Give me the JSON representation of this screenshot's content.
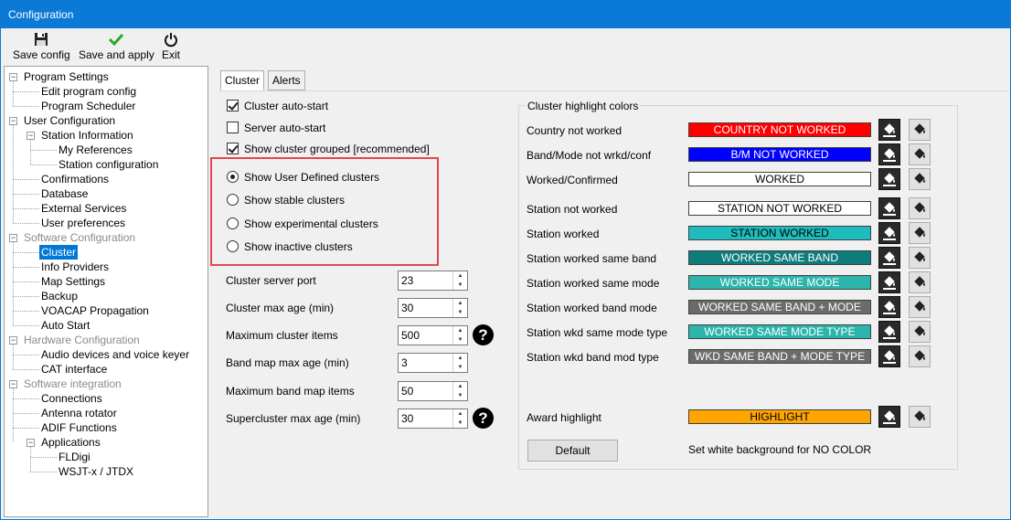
{
  "window": {
    "title": "Configuration"
  },
  "toolbar": {
    "save_config": "Save config",
    "save_and_apply": "Save and apply",
    "exit": "Exit"
  },
  "tree": [
    {
      "label": "Program Settings",
      "level": 0,
      "expander": "minus"
    },
    {
      "label": "Edit program config",
      "level": 1
    },
    {
      "label": "Program Scheduler",
      "level": 1
    },
    {
      "label": "User Configuration",
      "level": 0,
      "expander": "minus"
    },
    {
      "label": "Station Information",
      "level": 1,
      "expander": "minus"
    },
    {
      "label": "My References",
      "level": 2
    },
    {
      "label": "Station configuration",
      "level": 2
    },
    {
      "label": "Confirmations",
      "level": 1
    },
    {
      "label": "Database",
      "level": 1
    },
    {
      "label": "External Services",
      "level": 1
    },
    {
      "label": "User preferences",
      "level": 1
    },
    {
      "label": "Software Configuration",
      "level": 0,
      "expander": "minus",
      "grey": true
    },
    {
      "label": "Cluster",
      "level": 1,
      "selected": true
    },
    {
      "label": "Info Providers",
      "level": 1
    },
    {
      "label": "Map Settings",
      "level": 1
    },
    {
      "label": "Backup",
      "level": 1
    },
    {
      "label": "VOACAP Propagation",
      "level": 1
    },
    {
      "label": "Auto Start",
      "level": 1
    },
    {
      "label": "Hardware Configuration",
      "level": 0,
      "expander": "minus",
      "grey": true
    },
    {
      "label": "Audio devices and voice keyer",
      "level": 1
    },
    {
      "label": "CAT interface",
      "level": 1
    },
    {
      "label": "Software integration",
      "level": 0,
      "expander": "minus",
      "grey": true
    },
    {
      "label": "Connections",
      "level": 1
    },
    {
      "label": "Antenna rotator",
      "level": 1
    },
    {
      "label": "ADIF Functions",
      "level": 1
    },
    {
      "label": "Applications",
      "level": 1,
      "expander": "minus"
    },
    {
      "label": "FLDigi",
      "level": 2
    },
    {
      "label": "WSJT-x / JTDX",
      "level": 2
    }
  ],
  "tabs": [
    {
      "label": "Cluster",
      "active": true
    },
    {
      "label": "Alerts",
      "active": false
    }
  ],
  "cluster": {
    "checkboxes": [
      {
        "label": "Cluster auto-start",
        "checked": true
      },
      {
        "label": "Server auto-start",
        "checked": false
      },
      {
        "label": "Show cluster grouped [recommended]",
        "checked": true
      }
    ],
    "radios": [
      {
        "label": "Show User Defined clusters",
        "selected": true
      },
      {
        "label": "Show stable clusters",
        "selected": false
      },
      {
        "label": "Show experimental clusters",
        "selected": false
      },
      {
        "label": "Show inactive clusters",
        "selected": false
      }
    ],
    "fields": [
      {
        "label": "Cluster server port",
        "value": "23",
        "help": false
      },
      {
        "label": "Cluster max age (min)",
        "value": "30",
        "help": false
      },
      {
        "label": "Maximum cluster items",
        "value": "500",
        "help": true
      },
      {
        "label": "Band map max age (min)",
        "value": "3",
        "help": false
      },
      {
        "label": "Maximum band map items",
        "value": "50",
        "help": false
      },
      {
        "label": "Supercluster max age (min)",
        "value": "30",
        "help": true
      }
    ],
    "help_glyph": "?"
  },
  "highlight": {
    "title": "Cluster highlight colors",
    "rows": [
      {
        "label": "Country not worked",
        "text": "COUNTRY NOT WORKED",
        "bg": "#ff0000",
        "fg": "#ffffff"
      },
      {
        "label": "Band/Mode not wrkd/conf",
        "text": "B/M NOT WORKED",
        "bg": "#0000ff",
        "fg": "#ffffff"
      },
      {
        "label": "Worked/Confirmed",
        "text": "WORKED",
        "bg": "#ffffff",
        "fg": "#000000"
      },
      {
        "label": "Station not worked",
        "text": "STATION NOT WORKED",
        "bg": "#ffffff",
        "fg": "#000000"
      },
      {
        "label": "Station worked",
        "text": "STATION WORKED",
        "bg": "#1ebcbc",
        "fg": "#000000"
      },
      {
        "label": "Station worked same band",
        "text": "WORKED SAME BAND",
        "bg": "#0e7c7b",
        "fg": "#ffffff"
      },
      {
        "label": "Station worked same mode",
        "text": "WORKED SAME MODE",
        "bg": "#2bb5ab",
        "fg": "#ffffff"
      },
      {
        "label": "Station worked band mode",
        "text": "WORKED SAME BAND + MODE",
        "bg": "#6b6b6b",
        "fg": "#ffffff"
      },
      {
        "label": "Station wkd same mode type",
        "text": "WORKED SAME MODE TYPE",
        "bg": "#2bb5ab",
        "fg": "#ffffff"
      },
      {
        "label": "Station wkd band mod type",
        "text": "WKD SAME BAND + MODE TYPE",
        "bg": "#6b6b6b",
        "fg": "#ffffff"
      }
    ],
    "award": {
      "label": "Award highlight",
      "text": "HIGHLIGHT",
      "bg": "#ffa500",
      "fg": "#000000"
    },
    "default_button": "Default",
    "note": "Set white background for NO COLOR"
  }
}
